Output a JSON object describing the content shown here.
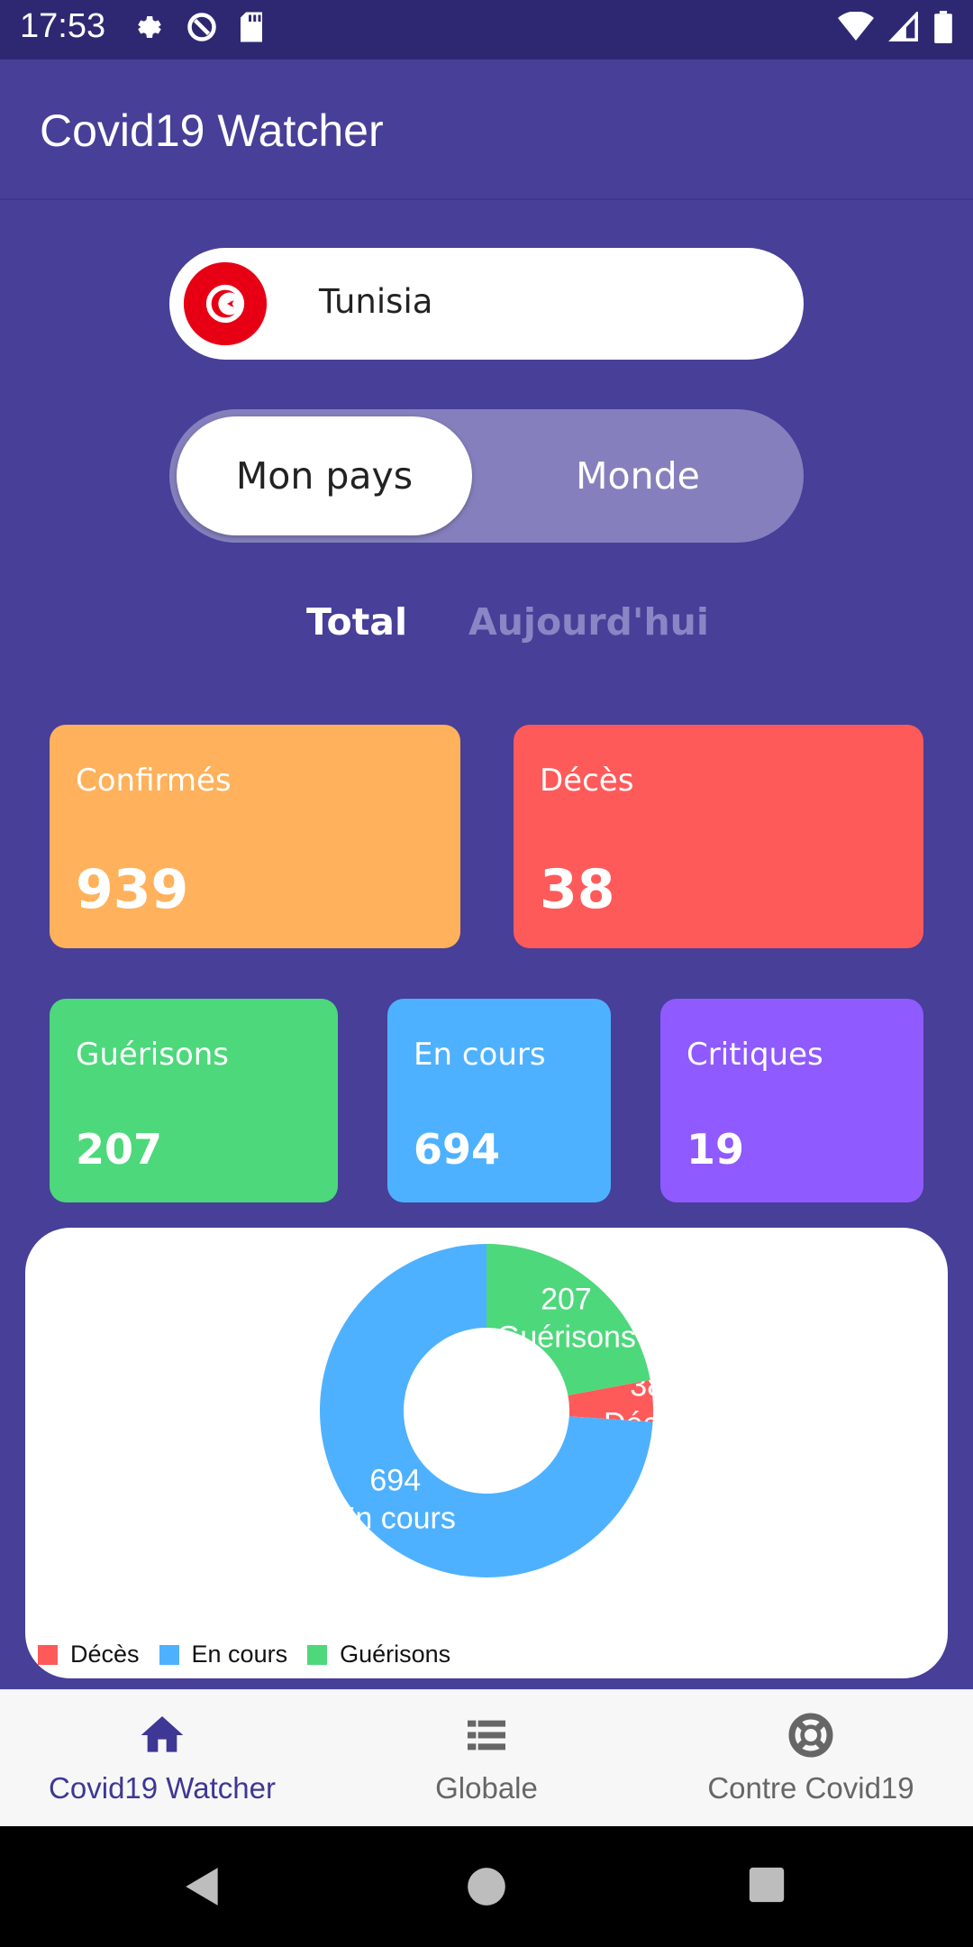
{
  "status_bar": {
    "time": "17:53"
  },
  "app_bar": {
    "title": "Covid19 Watcher"
  },
  "country_selector": {
    "country": "Tunisia",
    "flag_icon": "tunisia-flag-icon"
  },
  "scope_toggle": {
    "options": [
      "Mon pays",
      "Monde"
    ],
    "selected": "Mon pays"
  },
  "period_tabs": {
    "options": [
      "Total",
      "Aujourd'hui"
    ],
    "selected": "Total"
  },
  "stats": [
    {
      "label": "Confirmés",
      "value": "939",
      "color": "#ffb15b"
    },
    {
      "label": "Décès",
      "value": "38",
      "color": "#ff5a5a"
    },
    {
      "label": "Guérisons",
      "value": "207",
      "color": "#4dd87b"
    },
    {
      "label": "En cours",
      "value": "694",
      "color": "#4eb1ff"
    },
    {
      "label": "Critiques",
      "value": "19",
      "color": "#8f5aff"
    }
  ],
  "chart_data": {
    "type": "pie",
    "categories": [
      "Décès",
      "En cours",
      "Guérisons"
    ],
    "values": [
      38,
      694,
      207
    ],
    "colors": [
      "#ff5a5a",
      "#4eb1ff",
      "#4dd87b"
    ],
    "legend_position": "bottom-left"
  },
  "bottom_nav": {
    "items": [
      {
        "label": "Covid19 Watcher",
        "icon": "home-icon"
      },
      {
        "label": "Globale",
        "icon": "list-icon"
      },
      {
        "label": "Contre Covid19",
        "icon": "lifebuoy-icon"
      }
    ],
    "selected": "Covid19 Watcher"
  }
}
